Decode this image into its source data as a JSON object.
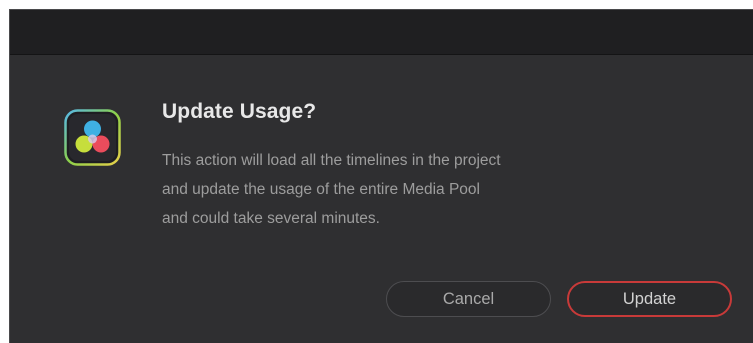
{
  "dialog": {
    "app_icon": "davinci-resolve-icon",
    "title": "Update Usage?",
    "message_lines": [
      "This action will load all the timelines in the project",
      "and update the usage of the entire Media Pool",
      "and could take several minutes."
    ],
    "buttons": {
      "cancel_label": "Cancel",
      "update_label": "Update"
    }
  },
  "colors": {
    "dialog_bg": "#2f2f31",
    "titlebar_bg": "#1f1f21",
    "primary_border": "#c83a39"
  }
}
